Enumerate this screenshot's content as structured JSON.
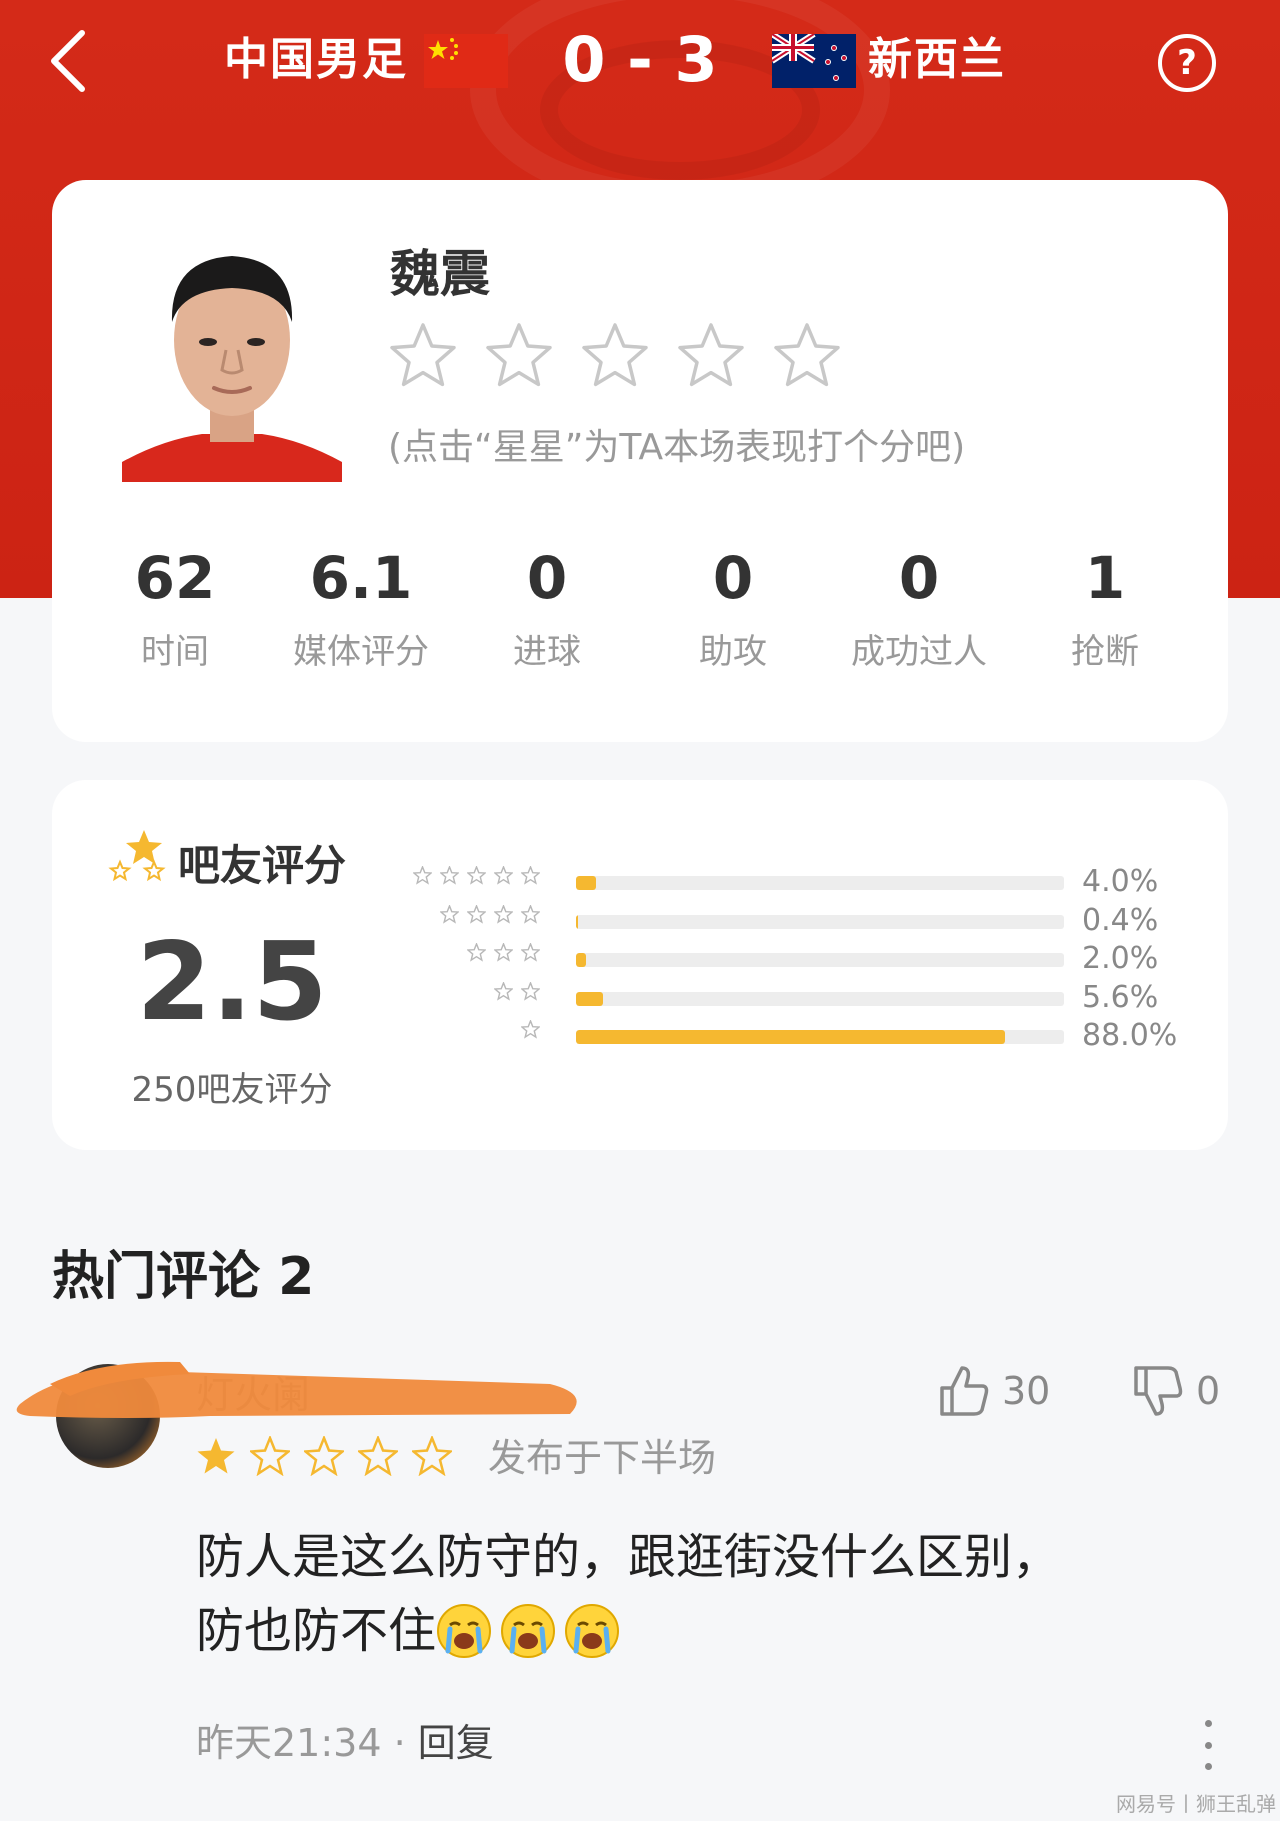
{
  "header": {
    "home_team": "中国男足",
    "away_team": "新西兰",
    "score": "0 - 3",
    "accent_color": "#cc2314"
  },
  "player": {
    "name": "魏震",
    "rating_hint": "(点击“星星”为TA本场表现打个分吧)",
    "stats": [
      {
        "value": "62",
        "label": "时间"
      },
      {
        "value": "6.1",
        "label": "媒体评分"
      },
      {
        "value": "0",
        "label": "进球"
      },
      {
        "value": "0",
        "label": "助攻"
      },
      {
        "value": "0",
        "label": "成功过人"
      },
      {
        "value": "1",
        "label": "抢断"
      }
    ]
  },
  "fan_rating": {
    "title": "吧友评分",
    "score": "2.5",
    "count_text": "250吧友评分",
    "distribution": [
      {
        "stars": 5,
        "percent": 4.0,
        "label": "4.0%"
      },
      {
        "stars": 4,
        "percent": 0.4,
        "label": "0.4%"
      },
      {
        "stars": 3,
        "percent": 2.0,
        "label": "2.0%"
      },
      {
        "stars": 2,
        "percent": 5.6,
        "label": "5.6%"
      },
      {
        "stars": 1,
        "percent": 88.0,
        "label": "88.0%"
      }
    ],
    "bar_color": "#f5b830"
  },
  "comments_section": {
    "title": "热门评论 2",
    "comment": {
      "user": "灯火阑",
      "rating": 1,
      "posted_in": "发布于下半场",
      "likes": "30",
      "dislikes": "0",
      "text_line1": "防人是这么防守的，跟逛街没什么区别，",
      "text_line2": "防也防不住",
      "time": "昨天21:34",
      "separator": " · ",
      "reply_label": "回复"
    }
  },
  "watermark": "网易号丨狮王乱弹"
}
